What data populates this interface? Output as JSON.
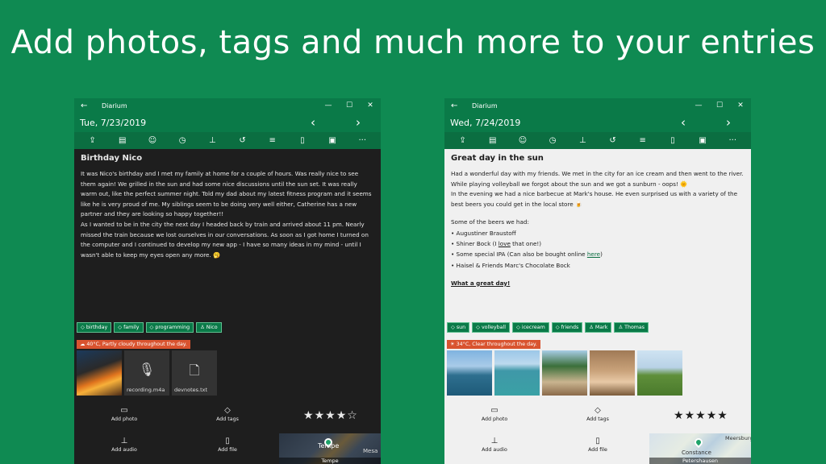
{
  "headline": "Add photos, tags and much more to your entries",
  "left": {
    "app_name": "Diarium",
    "date": "Tue, 7/23/2019",
    "entry_title": "Birthday Nico",
    "paragraphs": [
      "It was Nico's birthday and I met my family at home for a couple of hours. Was really nice to see them again! We grilled in the sun and had some nice discussions until the sun set. It was really warm out, like the perfect summer night. Told my dad about my latest fitness program and it seems like he is very proud of me. My siblings seem to be doing very well either, Catherine has a new partner and they are looking so happy together!!",
      "As I wanted to be in the city the next day I headed back by train and arrived about 11 pm. Nearly missed the train because we lost ourselves in our conversations. As soon as I got home I turned on the computer and I continued to develop my new app - I have so many ideas in my mind - until I wasn't able to keep my eyes open any more. 🥱"
    ],
    "tags": [
      {
        "icon": "tag-icon",
        "label": "birthday"
      },
      {
        "icon": "tag-icon",
        "label": "family"
      },
      {
        "icon": "tag-icon",
        "label": "programming"
      },
      {
        "icon": "person-icon",
        "label": "Nico"
      }
    ],
    "weather": "40°C, Partly cloudy throughout the day.",
    "files": [
      {
        "icon": "microphone-icon",
        "name": "recording.m4a"
      },
      {
        "icon": "file-icon",
        "name": "devnotes.txt"
      }
    ],
    "actions": {
      "add_photo": "Add photo",
      "add_tags": "Add tags",
      "add_audio": "Add audio",
      "add_file": "Add file"
    },
    "rating": 4,
    "rating_max": 5,
    "map_label": "Tempe",
    "map_text": "Tempe",
    "map_text2": "Mesa"
  },
  "right": {
    "app_name": "Diarium",
    "date": "Wed, 7/24/2019",
    "entry_title": "Great day in the sun",
    "p1": "Had a wonderful day with my friends. We met in the city for an ice cream and then went to the river. While playing volleyball we forgot about the sun and we got a sunburn - oops! 🌞",
    "p2": "In the evening we had a nice barbecue at Mark's house. He even surprised us with a variety of the best beers you could get in the local store 🍺",
    "list_intro": "Some of the beers we had:",
    "beers": {
      "b1": "• Augustiner Braustoff",
      "b2_pre": "• Shiner Bock (I ",
      "b2_u": "love",
      "b2_post": " that one!)",
      "b3_pre": "• Some special IPA (Can also be bought online ",
      "b3_link": "here",
      "b3_post": ")",
      "b4": "• Haisel & Friends Marc's Chocolate Bock"
    },
    "closing": "What a great day!",
    "tags": [
      {
        "icon": "tag-icon",
        "label": "sun"
      },
      {
        "icon": "tag-icon",
        "label": "volleyball"
      },
      {
        "icon": "tag-icon",
        "label": "icecream"
      },
      {
        "icon": "tag-icon",
        "label": "friends"
      },
      {
        "icon": "person-icon",
        "label": "Mark"
      },
      {
        "icon": "person-icon",
        "label": "Thomas"
      }
    ],
    "weather": "34°C, Clear throughout the day.",
    "actions": {
      "add_photo": "Add photo",
      "add_tags": "Add tags",
      "add_audio": "Add audio",
      "add_file": "Add file"
    },
    "rating": 5,
    "rating_max": 5,
    "map_label": "Petershausen",
    "map_text": "Constance",
    "map_text2": "Meersburg"
  },
  "colors": {
    "background": "#0f8a52",
    "titlebar": "#0a7a48",
    "toolbar": "#0b6e41",
    "weather": "#d9532f"
  },
  "toolbar_icons": [
    "share-icon",
    "layout-icon",
    "emoji-icon",
    "clock-icon",
    "microphone-icon",
    "history-icon",
    "format-icon",
    "delete-icon",
    "save-icon",
    "more-icon"
  ]
}
